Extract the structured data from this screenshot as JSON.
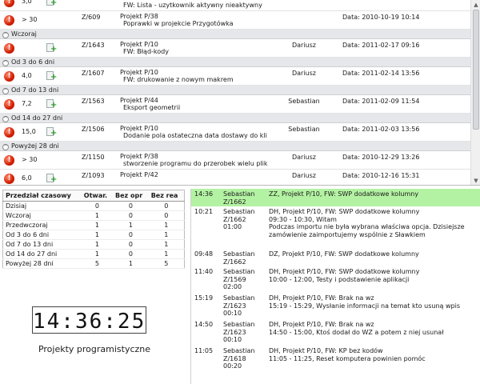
{
  "task_groups": [
    {
      "header": "",
      "tasks": [
        {
          "prio": "3,0",
          "code": "",
          "project": "",
          "desc": "FW: Lista - uzytkownik aktywny nieaktywny",
          "person": "",
          "date": "",
          "icon": "add-icon"
        },
        {
          "prio": "> 30",
          "code": "Z/609",
          "project": "Projekt P/38",
          "desc": "Poprawki w projekcie Przygotówka",
          "person": "",
          "date": "Data: 2010-10-19 10:14",
          "icon": ""
        }
      ]
    },
    {
      "header": "Wczoraj",
      "tasks": [
        {
          "prio": "",
          "code": "Z/1643",
          "project": "Projekt P/10",
          "desc": "FW: Błąd-kody",
          "person": "Dariusz",
          "date": "Data: 2011-02-17 09:16",
          "icon": "add-icon"
        }
      ]
    },
    {
      "header": "Od 3 do 6 dni",
      "tasks": [
        {
          "prio": "4,0",
          "code": "Z/1607",
          "project": "Projekt P/10",
          "desc": "FW: drukowanie z nowym makrem",
          "person": "Dariusz",
          "date": "Data: 2011-02-14 13:56",
          "icon": "add-icon"
        }
      ]
    },
    {
      "header": "Od 7 do 13 dni",
      "tasks": [
        {
          "prio": "7,2",
          "code": "Z/1563",
          "project": "Projekt P/44",
          "desc": "Eksport geometrii",
          "person": "Sebastian",
          "date": "Data: 2011-02-09 11:54",
          "icon": "add-icon"
        }
      ]
    },
    {
      "header": "Od 14 do 27 dni",
      "tasks": [
        {
          "prio": "15,0",
          "code": "Z/1506",
          "project": "Projekt P/10",
          "desc": "Dodanie pola ostateczna data dostawy do klient",
          "person": "Sebastian",
          "date": "Data: 2011-02-03 13:56",
          "icon": "add-icon"
        }
      ]
    },
    {
      "header": "Powyżej 28 dni",
      "tasks": [
        {
          "prio": "> 30",
          "code": "Z/1150",
          "project": "Projekt P/38",
          "desc": "stworzenie programu do przerobek wielu plikow",
          "person": "Dariusz",
          "date": "Data: 2010-12-29 13:26",
          "icon": ""
        },
        {
          "prio": "6,0",
          "code": "Z/1093",
          "project": "Projekt P/42",
          "desc": "",
          "person": "Dariusz",
          "date": "Data: 2010-12-16 15:31",
          "icon": "add-icon"
        }
      ]
    }
  ],
  "summary": {
    "headers": [
      "Przedział czasowy",
      "Otwar.",
      "Bez opr",
      "Bez rea"
    ],
    "rows": [
      [
        "Dzisiaj",
        "0",
        "0",
        "0"
      ],
      [
        "Wczoraj",
        "1",
        "0",
        "0"
      ],
      [
        "Przedwczoraj",
        "1",
        "1",
        "1"
      ],
      [
        "Od 3 do 6 dni",
        "1",
        "0",
        "1"
      ],
      [
        "Od 7 do 13 dni",
        "1",
        "0",
        "1"
      ],
      [
        "Od 14 do 27 dni",
        "1",
        "0",
        "1"
      ],
      [
        "Powyżej 28 dni",
        "5",
        "1",
        "5"
      ]
    ]
  },
  "clock": {
    "time": "14:36:25",
    "caption": "Projekty programistyczne"
  },
  "log": [
    {
      "time": "14:36",
      "person": "Sebastian",
      "code": "Z/1662",
      "duration": "",
      "lines": [
        "ZZ,  Projekt P/10, FW: SWP dodatkowe kolumny"
      ],
      "highlight": true
    },
    {
      "time": "10:21",
      "person": "Sebastian",
      "code": "Z/1662",
      "duration": "01:00",
      "lines": [
        "DH,  Projekt P/10, FW: SWP dodatkowe kolumny",
        "09:30 - 10:30, Witam",
        "Podczas importu nie była wybrana właściwa opcja. Dzisiejsze zamówienie zaimportujemy wspólnie z Sławkiem"
      ],
      "highlight": false
    },
    {
      "time": "09:48",
      "person": "Sebastian",
      "code": "Z/1662",
      "duration": "",
      "lines": [
        "DZ,  Projekt P/10, FW: SWP dodatkowe kolumny"
      ],
      "highlight": false
    },
    {
      "time": "11:40",
      "person": "Sebastian",
      "code": "Z/1569",
      "duration": "02:00",
      "lines": [
        "DH,  Projekt P/10, FW: SWP dodatkowe kolumny",
        "10:00 - 12:00, Testy i podstawienie aplikacji"
      ],
      "highlight": false
    },
    {
      "time": "15:19",
      "person": "Sebastian",
      "code": "Z/1623",
      "duration": "00:10",
      "lines": [
        "DH,  Projekt P/10, FW: Brak na wz",
        "15:19 - 15:29, Wysłanie informacji na temat kto usuną wpis"
      ],
      "highlight": false
    },
    {
      "time": "14:50",
      "person": "Sebastian",
      "code": "Z/1623",
      "duration": "00:10",
      "lines": [
        "DH,  Projekt P/10, FW: Brak na wz",
        "14:50 - 15:00, Ktoś dodał do WZ a potem z niej usunał"
      ],
      "highlight": false
    },
    {
      "time": "11:05",
      "person": "Sebastian",
      "code": "Z/1618",
      "duration": "00:20",
      "lines": [
        "DH,  Projekt P/10, FW: KP bez kodów",
        "11:05 - 11:25, Reset komputera powinien pomóc"
      ],
      "highlight": false
    }
  ]
}
